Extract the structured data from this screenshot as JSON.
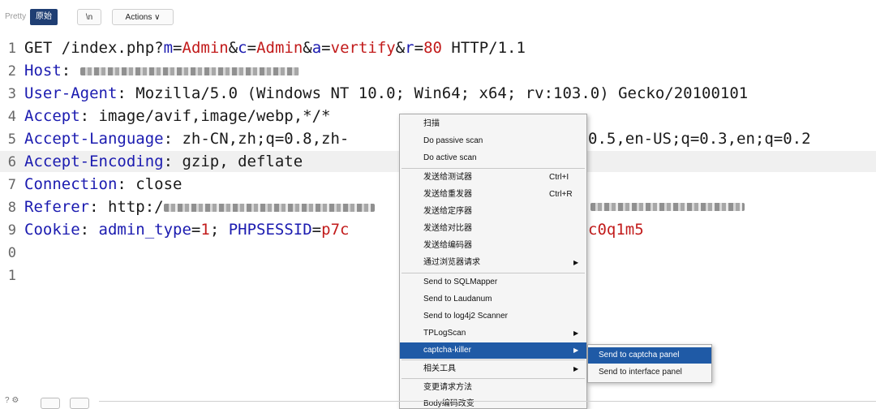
{
  "toolbar": {
    "pretty": "Pretty",
    "raw": "原始",
    "newline": "\\n",
    "actions": "Actions ∨"
  },
  "request": {
    "line1": {
      "n": "1",
      "method": "GET /index.php?",
      "p1": "m",
      "v1": "Admin",
      "p2": "c",
      "v2": "Admin",
      "p3": "a",
      "v3": "vertify",
      "p4": "r",
      "v4": "80",
      "proto": " HTTP/1.1"
    },
    "line2": {
      "n": "2",
      "key": "Host",
      "val": ": "
    },
    "line3": {
      "n": "3",
      "key": "User-Agent",
      "val": ": Mozilla/5.0 (Windows NT 10.0; Win64; x64; rv:103.0) Gecko/20100101"
    },
    "line4": {
      "n": "4",
      "key": "Accept",
      "val": ": image/avif,image/webp,*/*"
    },
    "line5": {
      "n": "5",
      "key": "Accept-Language",
      "val": ": zh-CN,zh;q=0.8,zh-",
      "tail": "0.5,en-US;q=0.3,en;q=0.2"
    },
    "line6": {
      "n": "6",
      "key": "Accept-Encoding",
      "val": ": gzip, deflate"
    },
    "line7": {
      "n": "7",
      "key": "Connection",
      "val": ": close"
    },
    "line8": {
      "n": "8",
      "key": "Referer",
      "val": ": http:/"
    },
    "line9": {
      "n": "9",
      "key": "Cookie",
      "sep": ": ",
      "c1": "admin_type",
      "c1v": "1",
      "semi": "; ",
      "c2": "PHPSESSID",
      "c2v": "p7c",
      "tail": "c0q1m5"
    },
    "line10": {
      "n": "0"
    },
    "line11": {
      "n": "1"
    }
  },
  "menu": {
    "items": [
      {
        "label": "扫描"
      },
      {
        "label": "Do passive scan"
      },
      {
        "label": "Do active scan"
      },
      {
        "label": "发送给测试器",
        "shortcut": "Ctrl+I"
      },
      {
        "label": "发送给重发器",
        "shortcut": "Ctrl+R"
      },
      {
        "label": "发送给定序器"
      },
      {
        "label": "发送给对比器"
      },
      {
        "label": "发送给编码器"
      },
      {
        "label": "通过浏览器请求",
        "arrow": "▶"
      },
      {
        "label": "Send to SQLMapper"
      },
      {
        "label": "Send to Laudanum"
      },
      {
        "label": "Send to log4j2 Scanner"
      },
      {
        "label": "TPLogScan",
        "arrow": "▶"
      },
      {
        "label": "captcha-killer",
        "arrow": "▶"
      },
      {
        "label": "相关工具",
        "arrow": "▶"
      },
      {
        "label": "变更请求方法"
      },
      {
        "label": "Body编码改变"
      }
    ]
  },
  "submenu": {
    "items": [
      {
        "label": "Send to captcha panel"
      },
      {
        "label": "Send to interface panel"
      }
    ]
  },
  "colors": {
    "selected": "#1f5aa6",
    "header_key": "#1b1bb0",
    "param_value": "#c21b1b"
  }
}
